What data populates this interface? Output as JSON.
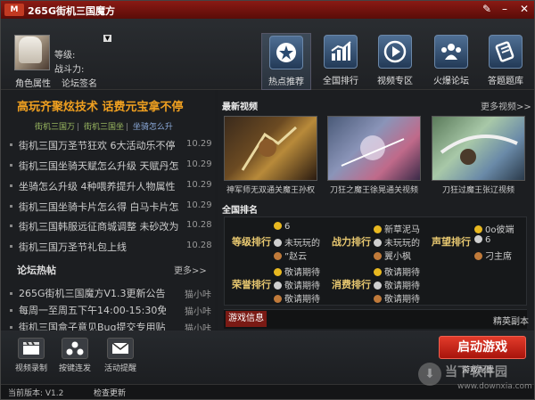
{
  "window": {
    "title": "265G街机三国魔方",
    "logo": "M"
  },
  "profile": {
    "level_label": "等级:",
    "power_label": "战斗力:",
    "role_attr": "角色属性",
    "forum_sign": "论坛签名"
  },
  "nav": [
    {
      "label": "热点推荐",
      "icon": "star-icon"
    },
    {
      "label": "全国排行",
      "icon": "bar-chart-icon"
    },
    {
      "label": "视频专区",
      "icon": "play-icon"
    },
    {
      "label": "火爆论坛",
      "icon": "people-icon"
    },
    {
      "label": "答题题库",
      "icon": "book-icon"
    }
  ],
  "promo": {
    "banner": "高玩齐聚炫技术 话费元宝拿不停",
    "links": [
      "街机三国万",
      "街机三国坐",
      "坐骑怎么升"
    ],
    "link_colors": [
      "#9ab860",
      "#9ab860",
      "#8aa8d8"
    ]
  },
  "news": [
    {
      "title": "街机三国万圣节狂欢 6大活动乐不停",
      "date": "10.29"
    },
    {
      "title": "街机三国坐骑天赋怎么升级 天赋丹怎么",
      "date": "10.29"
    },
    {
      "title": "坐骑怎么升级 4种喂养提升人物属性",
      "date": "10.29"
    },
    {
      "title": "街机三国坐骑卡片怎么得 白马卡片怎么",
      "date": "10.29"
    },
    {
      "title": "街机三国韩服远征商城调整 未砂改为天",
      "date": "10.28"
    },
    {
      "title": "街机三国万圣节礼包上线",
      "date": "10.28"
    }
  ],
  "forum": {
    "title": "论坛热帖",
    "more": "更多>>",
    "posts": [
      {
        "title": "265G街机三国魔方V1.3更新公告",
        "author": "猫小咔"
      },
      {
        "title": "每周一至周五下午14:00-15:30免免在",
        "author": "猫小咔"
      },
      {
        "title": "街机三国盒子意见Bug提交专用贴",
        "author": "猫小咔"
      }
    ]
  },
  "videos": {
    "title": "最新视频",
    "more": "更多视频>>",
    "items": [
      {
        "caption": "神军师无双通关魔王孙权"
      },
      {
        "caption": "刀狂之魔王徐晃通关视频"
      },
      {
        "caption": "刀狂过魔王张辽视频"
      }
    ]
  },
  "rankings": {
    "title": "全国排名",
    "groups": [
      {
        "category": "等级排行",
        "entries": [
          "6",
          "未玩玩的",
          "”赵云"
        ]
      },
      {
        "category": "战力排行",
        "entries": [
          "新草泥马",
          "未玩玩的",
          "翼小枫"
        ]
      },
      {
        "category": "声望排行",
        "entries": [
          "0o彼端",
          "6",
          "刁主席"
        ]
      },
      {
        "category": "荣誉排行",
        "entries": [
          "敬请期待",
          "敬请期待",
          "敬请期待"
        ]
      },
      {
        "category": "消费排行",
        "entries": [
          "敬请期待",
          "敬请期待",
          "敬请期待"
        ]
      }
    ]
  },
  "tabs": {
    "game_info": "游戏信息",
    "elite": "精英副本"
  },
  "tools": [
    {
      "label": "视频录制",
      "icon": "clapper-icon"
    },
    {
      "label": "按键连发",
      "icon": "keys-icon"
    },
    {
      "label": "活动提醒",
      "icon": "mail-icon"
    }
  ],
  "launch": {
    "label": "启动游戏",
    "config": "游戏配置"
  },
  "status": {
    "version": "当前版本: V1.2",
    "check_update": "检查更新"
  },
  "watermark": {
    "text": "当下软件园",
    "url": "www.downxia.com"
  },
  "colors": {
    "accent": "#c8281c",
    "banner": "#f0a020",
    "rank_category": "#e8c870"
  }
}
